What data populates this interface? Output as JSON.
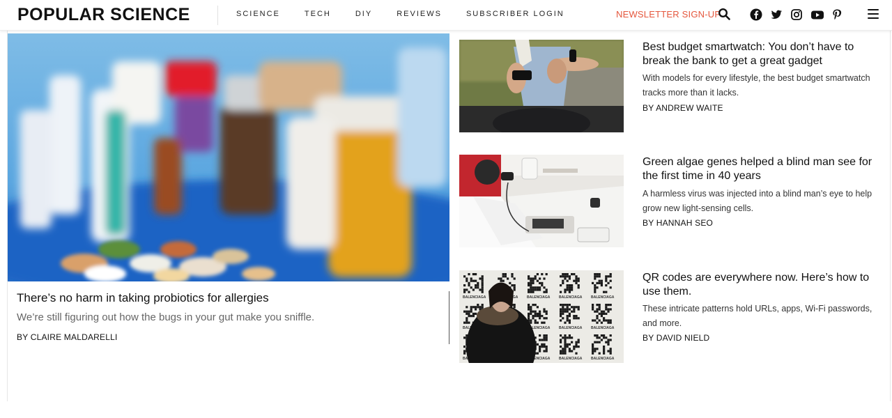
{
  "header": {
    "logo": "POPULAR SCIENCE",
    "nav": [
      "SCIENCE",
      "TECH",
      "DIY",
      "REVIEWS",
      "SUBSCRIBER LOGIN"
    ],
    "newsletter": "NEWSLETTER SIGN-UP",
    "icons": {
      "search": "search-icon",
      "social": [
        "facebook-icon",
        "twitter-icon",
        "instagram-icon",
        "youtube-icon",
        "pinterest-icon"
      ],
      "menu": "hamburger-menu-icon"
    },
    "accent_color": "#e5573d"
  },
  "hero": {
    "title": "There’s no harm in taking probiotics for allergies",
    "dek": "We’re still figuring out how the bugs in your gut make you sniffle.",
    "byline": "BY CLAIRE MALDARELLI"
  },
  "stories": [
    {
      "title": "Best budget smartwatch: You don’t have to break the bank to get a great gadget",
      "dek": "With models for every lifestyle, the best budget smartwatch tracks more than it lacks.",
      "byline": "BY ANDREW WAITE"
    },
    {
      "title": "Green algae genes helped a blind man see for the first time in 40 years",
      "dek": "A harmless virus was injected into a blind man’s eye to help grow new light-sensing cells.",
      "byline": "BY HANNAH SEO"
    },
    {
      "title": "QR codes are everywhere now. Here’s how to use them.",
      "dek": "These intricate patterns hold URLs, apps, Wi-Fi passwords, and more.",
      "byline": "BY DAVID NIELD",
      "image_text": "BALENCIAGA"
    }
  ]
}
